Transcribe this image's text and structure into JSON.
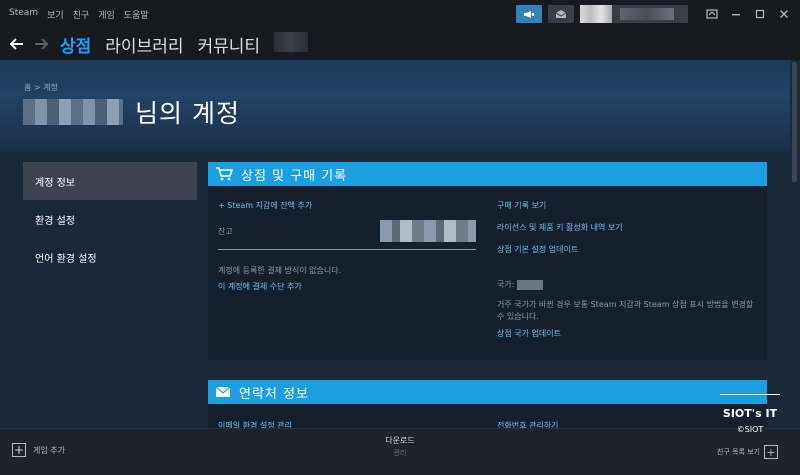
{
  "menu": [
    "Steam",
    "보기",
    "친구",
    "게임",
    "도움말"
  ],
  "icons": {
    "announce": "megaphone-icon",
    "mail": "envelope-icon",
    "monitor": "screen-icon",
    "cart": "cart-icon",
    "envelope": "envelope-icon"
  },
  "nav": {
    "store": "상점",
    "library": "라이브러리",
    "community": "커뮤니티"
  },
  "header": {
    "breadcrumb": "홈 > 계정",
    "title": "님의 계정"
  },
  "sidebar": {
    "items": [
      {
        "label": "계정 정보"
      },
      {
        "label": "환경 설정"
      },
      {
        "label": "언어 환경 설정"
      }
    ]
  },
  "store_panel": {
    "title": "상점 및 구매 기록",
    "add_funds": "+ Steam 지갑에 잔액 추가",
    "balance_label": "잔고",
    "no_payment": "계정에 등록한 결제 방식이 없습니다.",
    "add_payment": "이 계정에 결제 수단 추가",
    "purchase_history": "구매 기록 보기",
    "license_history": "라이선스 및 제품 키 활성화 내역 보기",
    "store_prefs": "상점 기본 설정 업데이트",
    "country_label": "국가:",
    "country_note": "거주 국가가 바뀐 경우 보통 Steam 지갑과 Steam 상점 표시 방법을 변경할 수 있습니다.",
    "update_country": "상점 국가 업데이트"
  },
  "contact_panel": {
    "title": "연락처 정보",
    "left_link": "이메일 환경 설정 관리",
    "right_link": "전화번호 관리하기"
  },
  "footer": {
    "add_game": "게임 추가",
    "downloads": "다운로드",
    "manage": "관리",
    "friends": "친구 목록 보기"
  },
  "watermark": {
    "title": "SIOT's IT",
    "copy": "©SIOT"
  },
  "colors": {
    "accent": "#1a9fff",
    "panel_header": "#1a9fe0",
    "link": "#66c0f4",
    "background": "#1b2838"
  }
}
